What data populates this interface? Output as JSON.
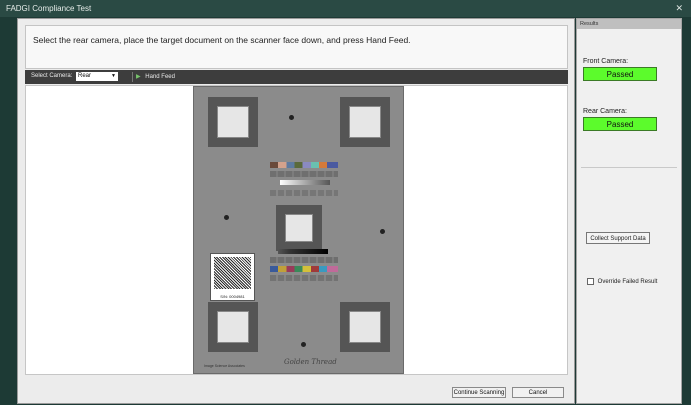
{
  "window": {
    "title": "FADGI Compliance Test",
    "close_icon": "close-icon"
  },
  "main": {
    "instruction": "Select the rear camera, place the target document on the scanner face down, and press Hand Feed.",
    "toolbar": {
      "select_label": "Select Camera:",
      "camera_value": "Rear",
      "hand_feed_label": "Hand Feed"
    },
    "scan": {
      "serial": "S/N: 0004981",
      "signature": "Golden Thread",
      "footer": "Image Science Associates"
    },
    "buttons": {
      "continue": "Continue Scanning",
      "cancel": "Cancel"
    }
  },
  "results": {
    "header": "Results",
    "front_label": "Front Camera:",
    "front_status": "Passed",
    "rear_label": "Rear Camera:",
    "rear_status": "Passed",
    "collect_label": "Collect Support Data",
    "override_label": "Override Failed Result"
  },
  "colors": {
    "accent_pass": "#5cfb2c",
    "toolbar_bg": "#3d3d3d",
    "titlebar_bg": "#2a4a44"
  }
}
